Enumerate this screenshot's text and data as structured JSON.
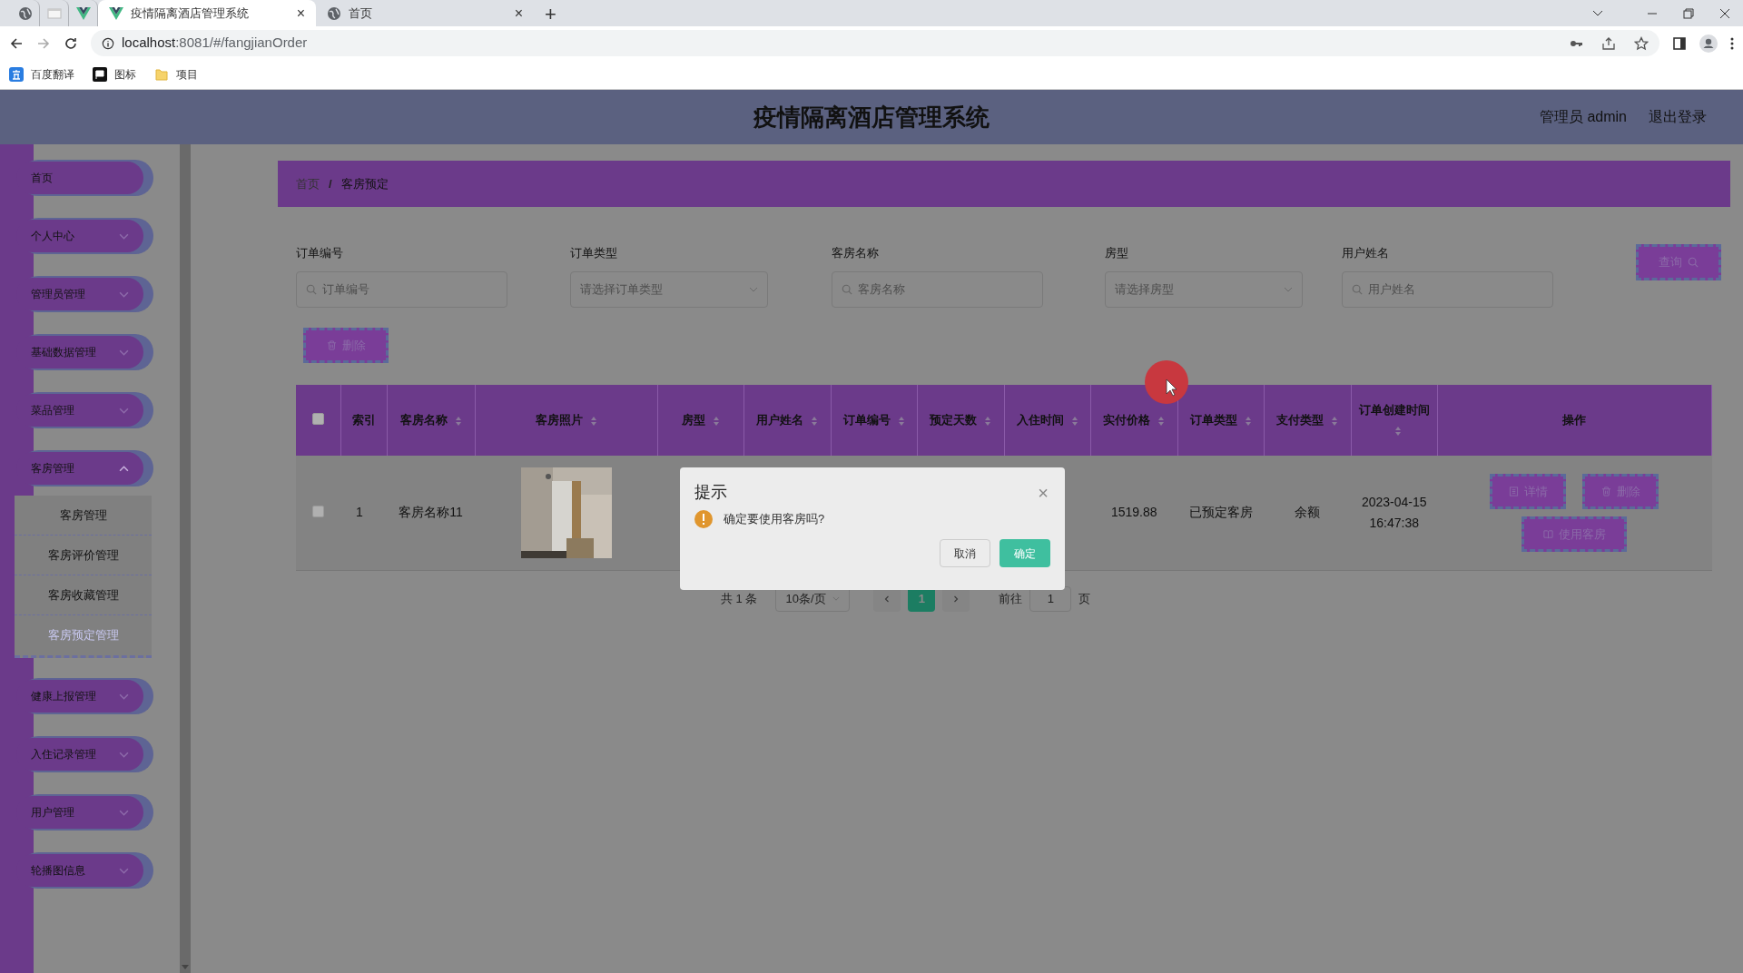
{
  "browser": {
    "tabs": [
      {
        "kind": "pinned",
        "selected": false
      },
      {
        "kind": "pinned",
        "selected": false
      },
      {
        "kind": "pinned",
        "selected": false
      },
      {
        "kind": "tab",
        "label": "疫情隔离酒店管理系统",
        "close": "×",
        "selected": true
      },
      {
        "kind": "tab",
        "label": "首页",
        "close": "×",
        "selected": false
      }
    ],
    "new_tab": "+",
    "url_host": "localhost",
    "url_rest": ":8081/#/fangjianOrder",
    "bookmarks": [
      {
        "label": "百度翻译"
      },
      {
        "label": "图标"
      },
      {
        "label": "项目"
      }
    ]
  },
  "header": {
    "title": "疫情隔离酒店管理系统",
    "user": "管理员 admin",
    "logout": "退出登录"
  },
  "sidebar": {
    "items": [
      {
        "label": "首页",
        "kind": "link"
      },
      {
        "label": "个人中心",
        "kind": "menu",
        "expanded": false
      },
      {
        "label": "管理员管理",
        "kind": "menu",
        "expanded": false
      },
      {
        "label": "基础数据管理",
        "kind": "menu",
        "expanded": false
      },
      {
        "label": "菜品管理",
        "kind": "menu",
        "expanded": false
      },
      {
        "label": "客房管理",
        "kind": "menu",
        "expanded": true,
        "children": [
          {
            "label": "客房管理",
            "selected": false
          },
          {
            "label": "客房评价管理",
            "selected": false
          },
          {
            "label": "客房收藏管理",
            "selected": false
          },
          {
            "label": "客房预定管理",
            "selected": true
          }
        ]
      },
      {
        "label": "健康上报管理",
        "kind": "menu",
        "expanded": false
      },
      {
        "label": "入住记录管理",
        "kind": "menu",
        "expanded": false
      },
      {
        "label": "用户管理",
        "kind": "menu",
        "expanded": false
      },
      {
        "label": "轮播图信息",
        "kind": "menu",
        "expanded": false
      }
    ]
  },
  "breadcrumb": {
    "items": [
      "首页",
      "客房预定"
    ],
    "separator": "/"
  },
  "search": {
    "fields": [
      {
        "label": "订单编号",
        "kind": "input",
        "placeholder": "订单编号"
      },
      {
        "label": "订单类型",
        "kind": "select",
        "placeholder": "请选择订单类型"
      },
      {
        "label": "客房名称",
        "kind": "input",
        "placeholder": "客房名称"
      },
      {
        "label": "房型",
        "kind": "select",
        "placeholder": "请选择房型"
      },
      {
        "label": "用户姓名",
        "kind": "input",
        "placeholder": "用户姓名"
      }
    ],
    "query_button": "查询",
    "delete_button": "删除"
  },
  "table": {
    "header_checked": false,
    "columns": [
      {
        "label": "索引",
        "sortable": false
      },
      {
        "label": "客房名称",
        "sortable": true
      },
      {
        "label": "客房照片",
        "sortable": true
      },
      {
        "label": "房型",
        "sortable": true
      },
      {
        "label": "用户姓名",
        "sortable": true
      },
      {
        "label": "订单编号",
        "sortable": true
      },
      {
        "label": "预定天数",
        "sortable": true
      },
      {
        "label": "入住时间",
        "sortable": true
      },
      {
        "label": "实付价格",
        "sortable": true
      },
      {
        "label": "订单类型",
        "sortable": true
      },
      {
        "label": "支付类型",
        "sortable": true
      },
      {
        "label": "订单创建时间",
        "sortable": true
      },
      {
        "label": "操作",
        "sortable": false
      }
    ],
    "rows": [
      {
        "checked": false,
        "index": "1",
        "room_name": "客房名称11",
        "photo": {
          "kind": "picture"
        },
        "price": "1519.88",
        "order_type": "已预定客房",
        "pay_type": "余额",
        "created": "2023-04-15 16:47:38",
        "actions": [
          "详情",
          "删除",
          "使用客房"
        ]
      }
    ]
  },
  "pagination": {
    "total": "共 1 条",
    "page_size": "10条/页",
    "pages": [
      {
        "label": "1",
        "selected": true
      }
    ],
    "goto_label": "前往",
    "goto_value": "1",
    "goto_suffix": "页"
  },
  "dialog": {
    "title": "提示",
    "close": "×",
    "message": "确定要使用客房吗?",
    "cancel": "取消",
    "confirm": "确定"
  }
}
